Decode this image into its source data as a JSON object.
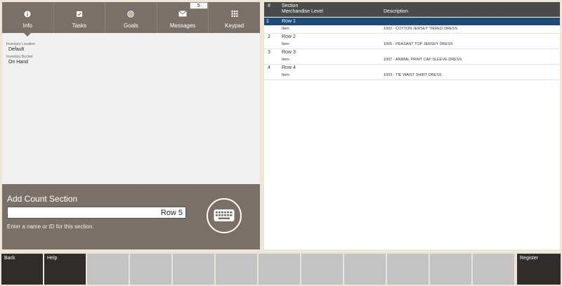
{
  "tabs": [
    {
      "label": "Info",
      "icon": "info-icon",
      "active": true
    },
    {
      "label": "Tasks",
      "icon": "checkbox-icon"
    },
    {
      "label": "Goals",
      "icon": "target-icon"
    },
    {
      "label": "Messages",
      "icon": "envelope-icon",
      "badge": "5"
    },
    {
      "label": "Keypad",
      "icon": "keypad-icon"
    }
  ],
  "inventory": {
    "location_label": "Inventory Location",
    "location_value": "Default",
    "bucket_label": "Inventory Bucket",
    "bucket_value": "On Hand"
  },
  "count_section": {
    "title": "Add Count Section",
    "input_value": "Row 5",
    "hint": "Enter a name or ID for this section."
  },
  "table": {
    "col_num": "#",
    "col_section": "Section",
    "col_level": "Merchandise Level",
    "col_desc": "Description",
    "rows": [
      {
        "num": "1",
        "section": "Row 1",
        "level": "Item",
        "desc": "1002 - COTTON JERSEY TIERED DRESS"
      },
      {
        "num": "2",
        "section": "Row 2",
        "level": "Item",
        "desc": "1005 - PEASANT TOP JERSEY DRESS"
      },
      {
        "num": "3",
        "section": "Row 3",
        "level": "Item",
        "desc": "1007 - ANIMAL PRINT CAP SLEEVE DRESS"
      },
      {
        "num": "4",
        "section": "Row 4",
        "level": "Item",
        "desc": "1003 - TIE WAIST SHIRT DRESS"
      }
    ]
  },
  "function_keys": {
    "back": "Back",
    "help": "Help",
    "register": "Register"
  },
  "colors": {
    "panel": "#7b7068",
    "selected_row": "#1c4b79",
    "header": "#4a4a4a",
    "background": "#efe7d6"
  }
}
